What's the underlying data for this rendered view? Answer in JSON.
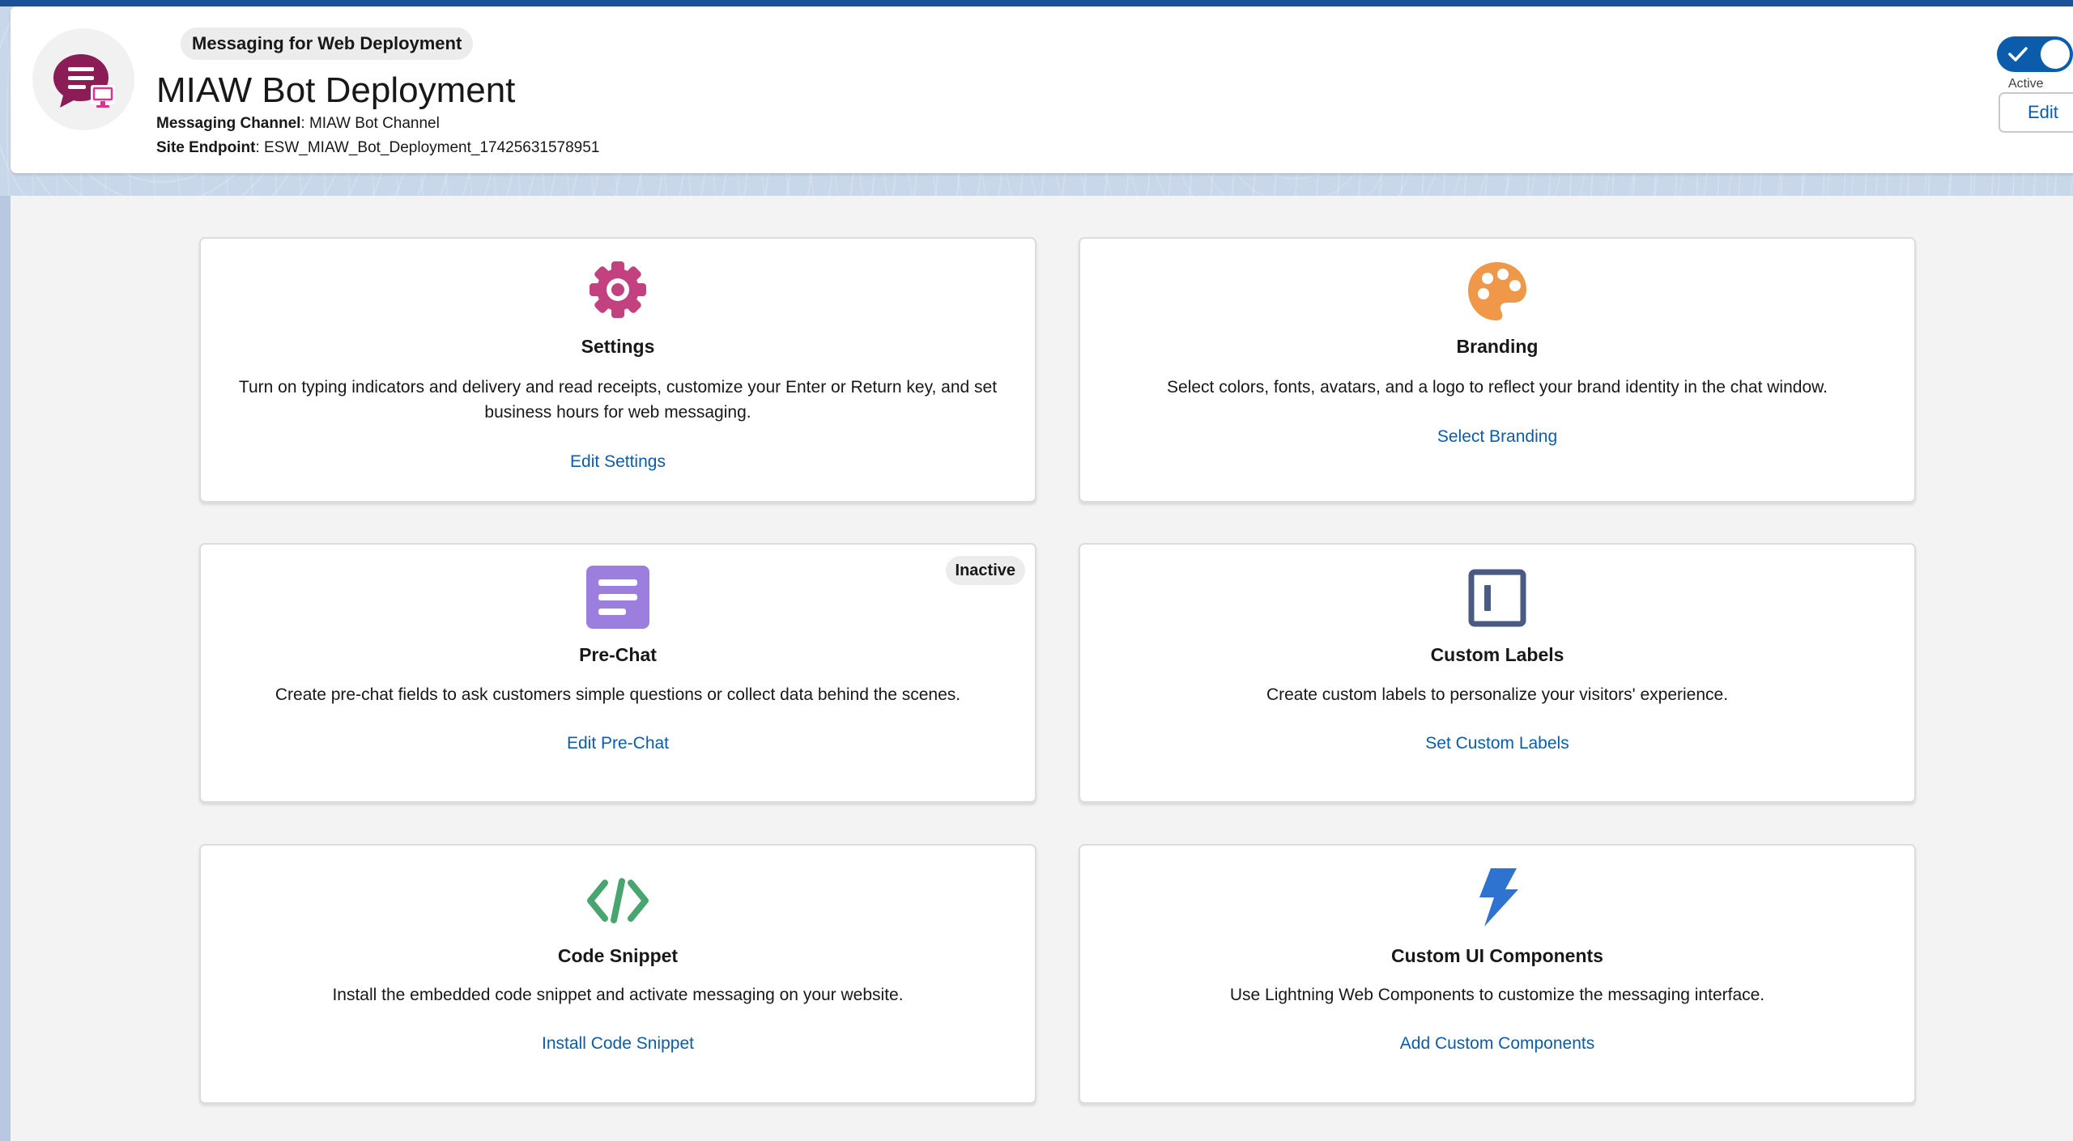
{
  "header": {
    "badge": "Messaging for Web Deployment",
    "title": "MIAW Bot Deployment",
    "channel_label": "Messaging Channel",
    "channel_value": ": MIAW Bot Channel",
    "endpoint_label": "Site Endpoint",
    "endpoint_value": ": ESW_MIAW_Bot_Deployment_17425631578951",
    "toggle_state": "on",
    "toggle_label": "Active",
    "edit_label": "Edit"
  },
  "colors": {
    "brand_blue": "#0b5cab",
    "avatar_icon": "#8b1d56",
    "settings_icon": "#c2417f",
    "branding_icon": "#f0984a",
    "prechat_icon": "#9b7ede",
    "labels_icon": "#4a5a82",
    "code_icon": "#48a56f",
    "components_icon": "#2f73d1"
  },
  "cards": [
    {
      "icon": "gear-icon",
      "title": "Settings",
      "description_line1": "Turn on typing indicators and delivery and read receipts, customize your Enter or Return key, and set",
      "description_line2": "business hours for web messaging.",
      "link": "Edit Settings"
    },
    {
      "icon": "palette-icon",
      "title": "Branding",
      "description_line1": "Select colors, fonts, avatars, and a logo to reflect your brand identity in the chat window.",
      "link": "Select Branding"
    },
    {
      "icon": "form-icon",
      "title": "Pre-Chat",
      "status": "Inactive",
      "description_line1": "Create pre-chat fields to ask customers simple questions or collect data behind the scenes.",
      "link": "Edit Pre-Chat"
    },
    {
      "icon": "label-icon",
      "title": "Custom Labels",
      "description_line1": "Create custom labels to personalize your visitors' experience.",
      "link": "Set Custom Labels"
    },
    {
      "icon": "code-icon",
      "title": "Code Snippet",
      "description_line1": "Install the embedded code snippet and activate messaging on your website.",
      "link": "Install Code Snippet"
    },
    {
      "icon": "lightning-icon",
      "title": "Custom UI Components",
      "description_line1": "Use Lightning Web Components to customize the messaging interface.",
      "link": "Add Custom Components"
    }
  ]
}
